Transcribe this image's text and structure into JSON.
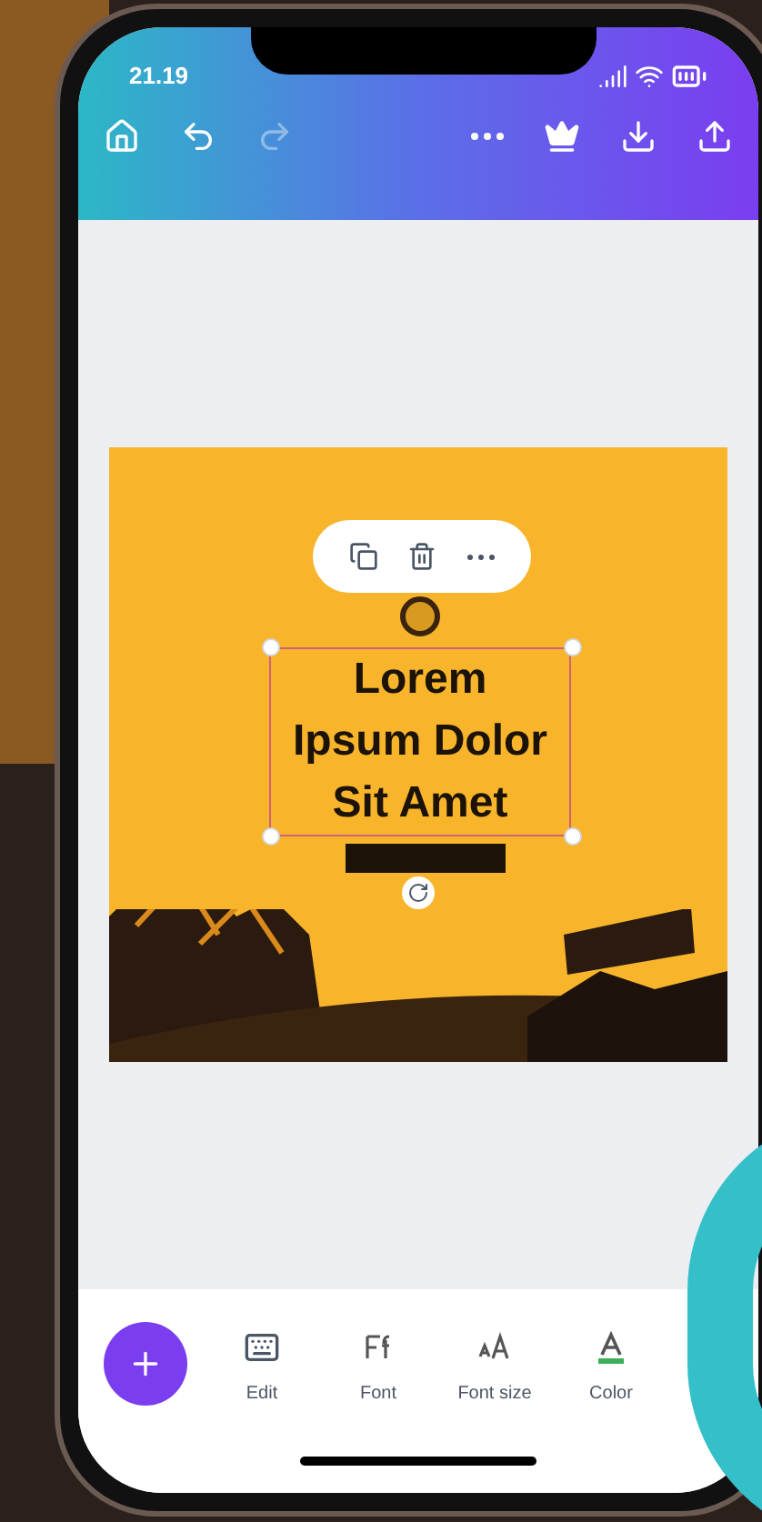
{
  "status_bar": {
    "time": "21.19"
  },
  "design": {
    "headline": "Lorem\nIpsum Dolor\nSit Amet"
  },
  "bottom_toolbar": {
    "items": [
      {
        "kind": "edit",
        "label": "Edit"
      },
      {
        "kind": "font",
        "label": "Font"
      },
      {
        "kind": "size",
        "label": "Font size"
      },
      {
        "kind": "color",
        "label": "Color"
      }
    ]
  }
}
